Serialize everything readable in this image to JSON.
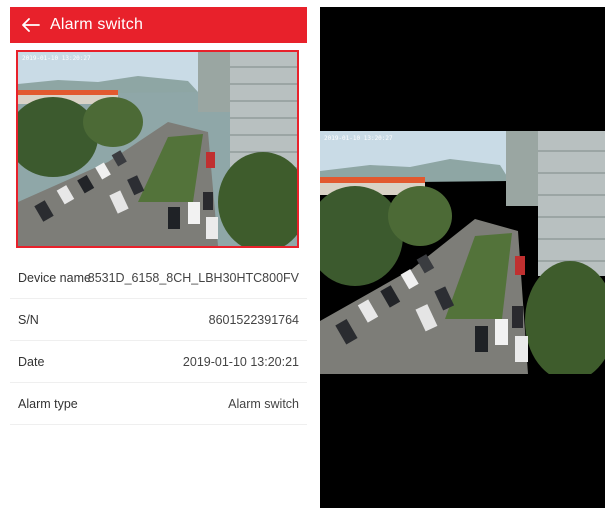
{
  "header": {
    "title": "Alarm switch",
    "back_icon": "arrow-left-icon",
    "color": "#e8212b"
  },
  "preview": {
    "osd_timestamp": "2019-01-10 13:20:27"
  },
  "details": {
    "rows": [
      {
        "label": "Device name",
        "value": "8531D_6158_8CH_LBH30HTC800FV"
      },
      {
        "label": "S/N",
        "value": "8601522391764"
      },
      {
        "label": "Date",
        "value": "2019-01-10 13:20:21"
      },
      {
        "label": "Alarm type",
        "value": "Alarm switch"
      }
    ]
  },
  "fullscreen": {
    "osd_timestamp": "2019-01-10 13:20:27"
  }
}
